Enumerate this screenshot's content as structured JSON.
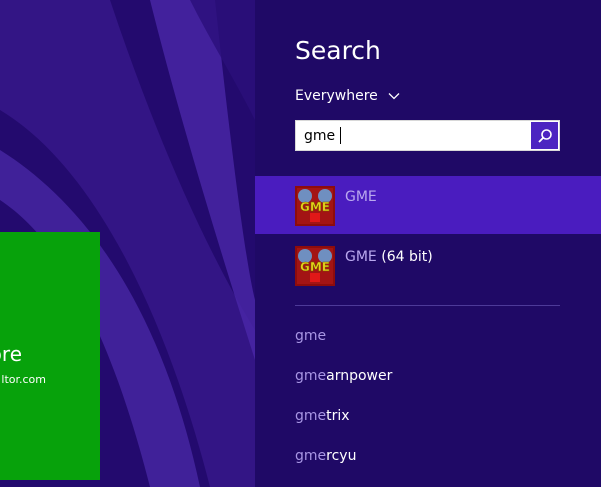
{
  "start_screen": {
    "tile": {
      "title": "ore",
      "subtitle": "ltor.com",
      "color": "#07a20b"
    },
    "background_color": "#230a6e"
  },
  "search_pane": {
    "title": "Search",
    "scope": {
      "label": "Everywhere",
      "icon": "chevron-down-icon"
    },
    "search": {
      "value": "gme",
      "button_icon": "search-icon"
    },
    "app_results": [
      {
        "match": "GME",
        "rest": "",
        "icon": "gme-app-icon",
        "selected": true
      },
      {
        "match": "GME",
        "rest": " (64 bit)",
        "icon": "gme-app-icon",
        "selected": false
      }
    ],
    "suggestions": [
      {
        "match": "gme",
        "rest": ""
      },
      {
        "match": "gme",
        "rest": "arnpower"
      },
      {
        "match": "gme",
        "rest": "trix"
      },
      {
        "match": "gme",
        "rest": "rcyu"
      }
    ],
    "colors": {
      "pane_bg": "#1f0966",
      "selected_bg": "#4a1cbf",
      "accent": "#4c24c1"
    }
  }
}
